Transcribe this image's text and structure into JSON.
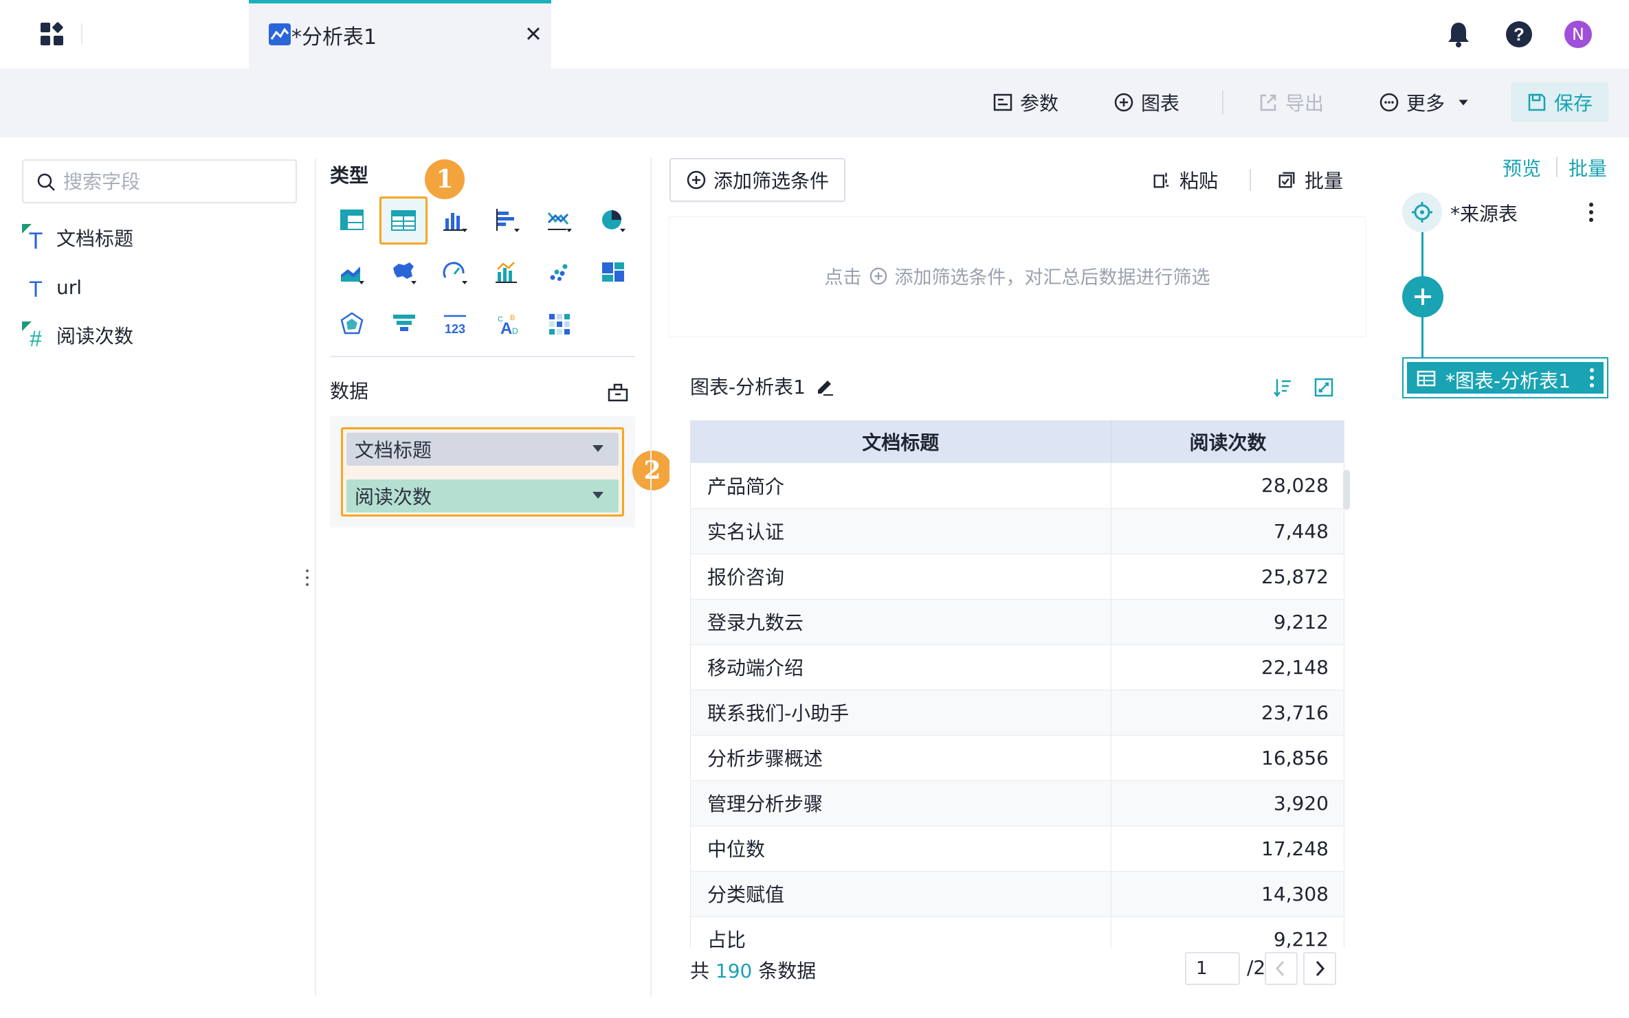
{
  "tab": {
    "title": "*分析表1"
  },
  "user": {
    "avatar_initial": "N"
  },
  "toolbar": {
    "params_label": "参数",
    "chart_label": "图表",
    "export_label": "导出",
    "more_label": "更多",
    "save_label": "保存"
  },
  "fields": {
    "search_placeholder": "搜索字段",
    "items": [
      {
        "label": "文档标题",
        "type": "text-calculated"
      },
      {
        "label": "url",
        "type": "text"
      },
      {
        "label": "阅读次数",
        "type": "number-calculated"
      }
    ]
  },
  "type_panel": {
    "label": "类型",
    "badge_1": "1",
    "selected": "detail-table",
    "chart_types": [
      "pivot-table-icon",
      "detail-table-icon",
      "column-chart-icon",
      "bar-chart-icon",
      "line-chart-icon",
      "pie-chart-icon",
      "area-chart-icon",
      "map-chart-icon",
      "gauge-chart-icon",
      "combo-chart-icon",
      "scatter-chart-icon",
      "treemap-chart-icon",
      "radar-chart-icon",
      "funnel-chart-icon",
      "kpi-number-icon",
      "word-cloud-icon",
      "heatmap-chart-icon"
    ]
  },
  "data_panel": {
    "label": "数据",
    "badge_2": "2",
    "dimension": "文档标题",
    "measure": "阅读次数"
  },
  "filter": {
    "add_label": "添加筛选条件",
    "paste_label": "粘贴",
    "batch_label": "批量",
    "hint_prefix": "点击",
    "hint_suffix": "添加筛选条件，对汇总后数据进行筛选"
  },
  "chart": {
    "title": "图表-分析表1",
    "columns": [
      "文档标题",
      "阅读次数"
    ],
    "rows": [
      [
        "产品简介",
        "28,028"
      ],
      [
        "实名认证",
        "7,448"
      ],
      [
        "报价咨询",
        "25,872"
      ],
      [
        "登录九数云",
        "9,212"
      ],
      [
        "移动端介绍",
        "22,148"
      ],
      [
        "联系我们-小助手",
        "23,716"
      ],
      [
        "分析步骤概述",
        "16,856"
      ],
      [
        "管理分析步骤",
        "3,920"
      ],
      [
        "中位数",
        "17,248"
      ],
      [
        "分类赋值",
        "14,308"
      ],
      [
        "占比",
        "9,212"
      ]
    ],
    "footer_prefix": "共",
    "total_count": "190",
    "footer_suffix": "条数据",
    "current_page": "1",
    "total_pages": "/2"
  },
  "flow": {
    "preview_label": "预览",
    "batch_label": "批量",
    "source_label": "*来源表",
    "chart_node_label": "*图表-分析表1"
  },
  "colors": {
    "accent": "#19a3b3",
    "highlight": "#f5a623",
    "dimension_pill": "#d3d8e2",
    "measure_pill": "#b4dfd1",
    "avatar": "#a04fd9"
  }
}
